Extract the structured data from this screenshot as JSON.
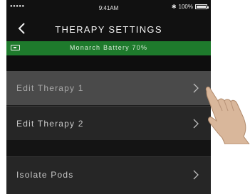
{
  "status_bar": {
    "signal": "●●●●●",
    "time": "9:41AM",
    "bluetooth": "✱",
    "battery_percent": "100%",
    "battery_level": 1.0
  },
  "nav": {
    "title": "THERAPY SETTINGS",
    "back_icon": "chevron-left-icon"
  },
  "battery_banner": {
    "text": "Monarch Battery 70%",
    "color": "#1e7a2c"
  },
  "menu": {
    "items": [
      {
        "label": "Edit Therapy 1",
        "highlighted": true
      },
      {
        "label": "Edit Therapy 2",
        "highlighted": false
      },
      {
        "label": "Isolate Pods",
        "highlighted": false
      }
    ]
  },
  "annotation": {
    "icon": "pointing-hand-icon"
  }
}
